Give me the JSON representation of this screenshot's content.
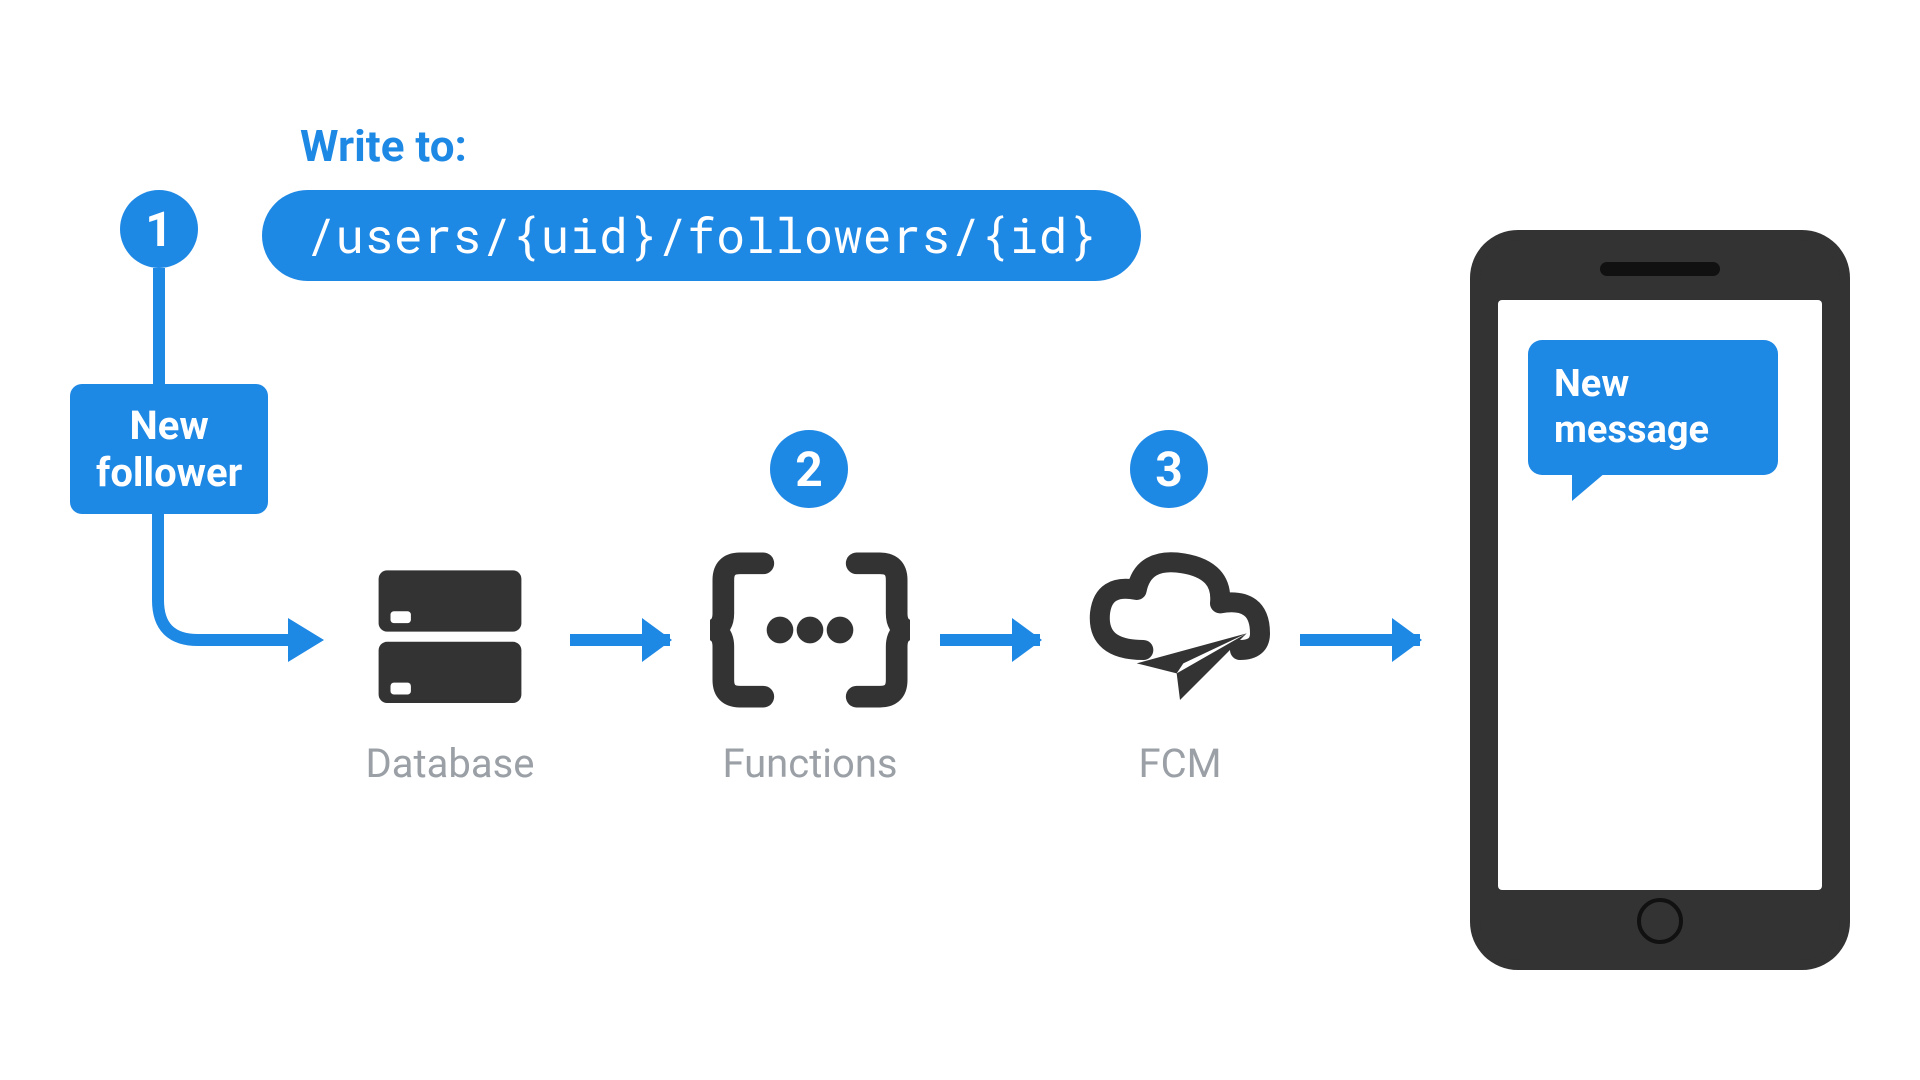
{
  "header": {
    "write_label": "Write to:",
    "path_text": "/users/{uid}/followers/{id}"
  },
  "steps": {
    "one": "1",
    "two": "2",
    "three": "3"
  },
  "trigger": {
    "label_line1": "New",
    "label_line2": "follower"
  },
  "nodes": {
    "database_label": "Database",
    "functions_label": "Functions",
    "fcm_label": "FCM"
  },
  "phone": {
    "bubble_line1": "New",
    "bubble_line2": "message"
  },
  "colors": {
    "accent": "#1e88e5",
    "icon": "#333333",
    "label": "#9aa0a6"
  }
}
